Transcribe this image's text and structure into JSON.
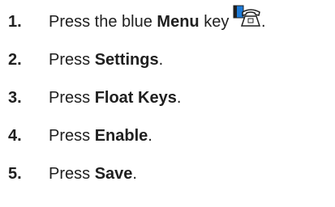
{
  "steps": [
    {
      "num": "1.",
      "pre": "Press the blue ",
      "key": "Menu",
      "post": " key",
      "icon": "menu-phone-icon",
      "end": "."
    },
    {
      "num": "2.",
      "pre": "Press ",
      "key": "Settings",
      "post": "."
    },
    {
      "num": "3.",
      "pre": "Press ",
      "key": "Float Keys",
      "post": "."
    },
    {
      "num": "4.",
      "pre": "Press ",
      "key": "Enable",
      "post": "."
    },
    {
      "num": "5.",
      "pre": "Press ",
      "key": "Save",
      "post": "."
    }
  ],
  "colors": {
    "text": "#202020",
    "icon_blue": "#1c7ad8",
    "icon_dark": "#202020"
  }
}
